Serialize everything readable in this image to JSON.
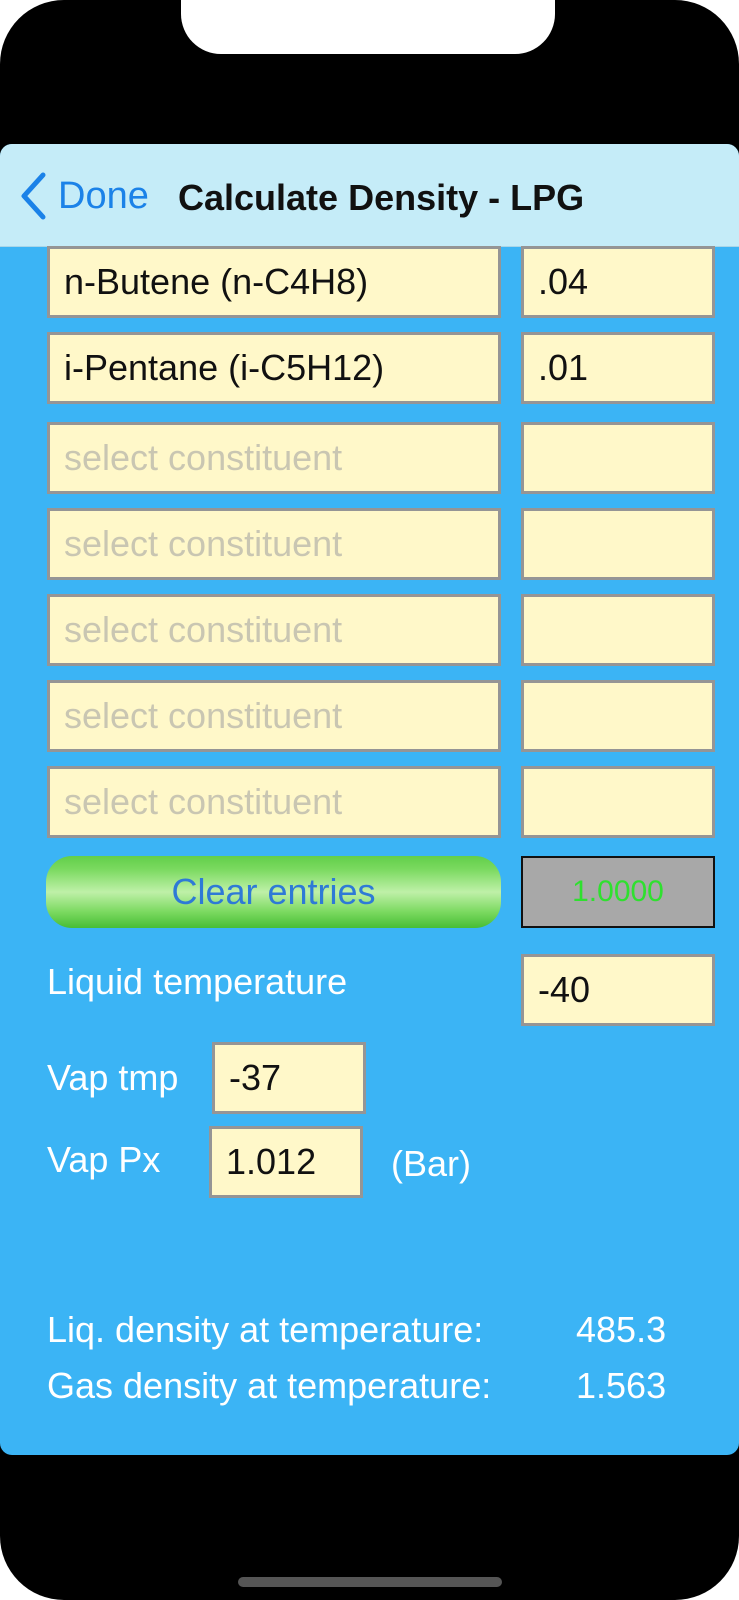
{
  "navbar": {
    "back_label": "Done",
    "title": "Calculate Density - LPG"
  },
  "constituents": [
    {
      "name": "n-Butene (n-C4H8)",
      "value": ".04"
    },
    {
      "name": "i-Pentane (i-C5H12)",
      "value": ".01"
    },
    {
      "name": "",
      "placeholder": "select constituent",
      "value": ""
    },
    {
      "name": "",
      "placeholder": "select constituent",
      "value": ""
    },
    {
      "name": "",
      "placeholder": "select constituent",
      "value": ""
    },
    {
      "name": "",
      "placeholder": "select constituent",
      "value": ""
    },
    {
      "name": "",
      "placeholder": "select constituent",
      "value": ""
    }
  ],
  "clear_button_label": "Clear entries",
  "total": "1.0000",
  "liquid_temperature": {
    "label": "Liquid temperature",
    "value": "-40"
  },
  "vap_tmp": {
    "label": "Vap tmp",
    "value": "-37"
  },
  "vap_px": {
    "label": "Vap Px",
    "value": "1.012",
    "unit": "(Bar)"
  },
  "results": {
    "liq_label": "Liq. density at temperature:",
    "liq_value": "485.3",
    "gas_label": "Gas density at temperature:",
    "gas_value": "1.563"
  },
  "colors": {
    "background": "#3bb4f5",
    "navbar": "#c5ecf8",
    "field": "#fff8c9",
    "accent": "#1b82e8",
    "total_text": "#2fe02f"
  }
}
